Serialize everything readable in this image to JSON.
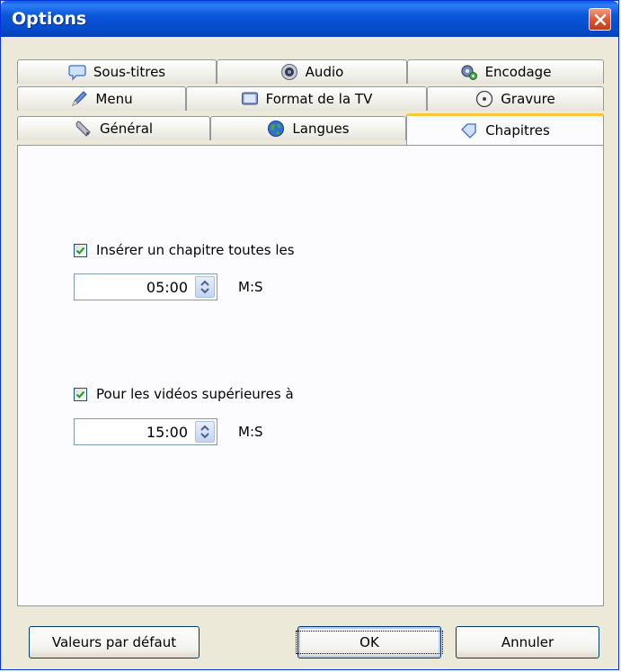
{
  "window": {
    "title": "Options"
  },
  "tabs": {
    "row1": [
      {
        "label": "Sous-titres",
        "icon": "speech-bubble-icon"
      },
      {
        "label": "Audio",
        "icon": "speaker-icon"
      },
      {
        "label": "Encodage",
        "icon": "gears-icon"
      }
    ],
    "row2": [
      {
        "label": "Menu",
        "icon": "pen-icon"
      },
      {
        "label": "Format de la TV",
        "icon": "tv-screen-icon"
      },
      {
        "label": "Gravure",
        "icon": "disc-icon"
      }
    ],
    "row3": [
      {
        "label": "Général",
        "icon": "wrench-icon"
      },
      {
        "label": "Langues",
        "icon": "globe-icon"
      },
      {
        "label": "Chapitres",
        "icon": "tag-icon",
        "active": true
      }
    ]
  },
  "chapters": {
    "insert_every": {
      "label": "Insérer un chapitre toutes les",
      "checked": true,
      "value": "05:00",
      "unit": "M:S"
    },
    "videos_longer_than": {
      "label": "Pour les vidéos supérieures à",
      "checked": true,
      "value": "15:00",
      "unit": "M:S"
    }
  },
  "buttons": {
    "defaults": "Valeurs par défaut",
    "ok": "OK",
    "cancel": "Annuler"
  }
}
